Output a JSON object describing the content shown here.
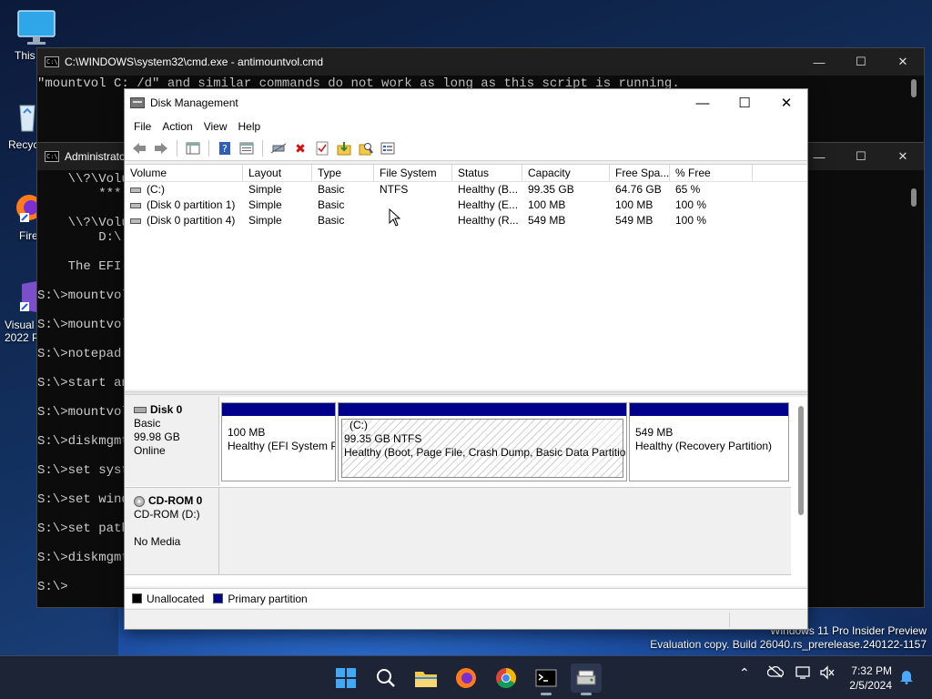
{
  "desktop": {
    "icons": [
      {
        "label": "This"
      },
      {
        "label": "Recyc"
      },
      {
        "label": "Fire"
      },
      {
        "label": "Visual",
        "sub": "2022 P"
      }
    ],
    "watermark": {
      "line1": "Windows 11 Pro Insider Preview",
      "line2": "Evaluation copy. Build 26040.rs_prerelease.240122-1157"
    }
  },
  "console_back": {
    "title": "C:\\WINDOWS\\system32\\cmd.exe - antimountvol.cmd",
    "text": "\"mountvol C: /d\" and similar commands do not work as long as this script is running."
  },
  "console_front": {
    "title": "Administrato",
    "lines": [
      "    \\\\?\\Volu",
      "        ***",
      "",
      "    \\\\?\\Volu",
      "        D:\\",
      "",
      "    The EFI",
      "",
      "S:\\>mountvol",
      "",
      "S:\\>mountvol",
      "",
      "S:\\>notepad",
      "",
      "S:\\>start an",
      "",
      "S:\\>mountvol",
      "",
      "S:\\>diskmgmt",
      "",
      "S:\\>set syst",
      "",
      "S:\\>set wind",
      "",
      "S:\\>set path",
      "",
      "S:\\>diskmgmt",
      "",
      "S:\\>"
    ]
  },
  "dm": {
    "title": "Disk Management",
    "menu": [
      "File",
      "Action",
      "View",
      "Help"
    ],
    "toolbar_icons": [
      "back-icon",
      "forward-icon",
      "sep",
      "console-tree-icon",
      "sep",
      "help-icon",
      "properties-icon",
      "sep",
      "connect-icon",
      "delete-icon",
      "check-icon",
      "import-icon",
      "search-icon",
      "list-icon"
    ],
    "columns": [
      "Volume",
      "Layout",
      "Type",
      "File System",
      "Status",
      "Capacity",
      "Free Spa...",
      "% Free"
    ],
    "rows": [
      [
        "(C:)",
        "Simple",
        "Basic",
        "NTFS",
        "Healthy (B...",
        "99.35 GB",
        "64.76 GB",
        "65 %"
      ],
      [
        "(Disk 0 partition 1)",
        "Simple",
        "Basic",
        "",
        "Healthy (E...",
        "100 MB",
        "100 MB",
        "100 %"
      ],
      [
        "(Disk 0 partition 4)",
        "Simple",
        "Basic",
        "",
        "Healthy (R...",
        "549 MB",
        "549 MB",
        "100 %"
      ]
    ],
    "disks": [
      {
        "name": "Disk 0",
        "type": "Basic",
        "size": "99.98 GB",
        "state": "Online",
        "partitions": [
          {
            "title": "",
            "line1": "100 MB",
            "line2": "Healthy (EFI System P"
          },
          {
            "title": "(C:)",
            "line1": "99.35 GB NTFS",
            "line2": "Healthy (Boot, Page File, Crash Dump, Basic Data Partition)"
          },
          {
            "title": "",
            "line1": "549 MB",
            "line2": "Healthy (Recovery Partition)"
          }
        ]
      },
      {
        "name": "CD-ROM 0",
        "type": "CD-ROM (D:)",
        "state": "No Media"
      }
    ],
    "legend": [
      {
        "label": "Unallocated",
        "color": "#000000"
      },
      {
        "label": "Primary partition",
        "color": "#00008b"
      }
    ]
  },
  "taskbar": {
    "apps": [
      "start-icon",
      "search-icon",
      "file-explorer-icon",
      "firefox-icon",
      "chrome-icon",
      "terminal-icon",
      "disk-management-icon"
    ],
    "time": "7:32 PM",
    "date": "2/5/2024"
  },
  "colors": {
    "primary_partition": "#00008b",
    "console_bg": "#0c0c0c",
    "taskbar_bg": "#1c2435"
  }
}
